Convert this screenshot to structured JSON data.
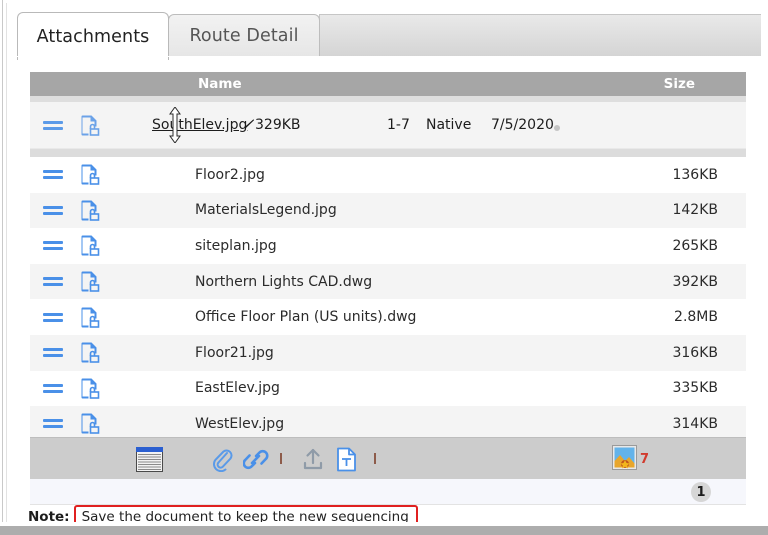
{
  "tabs": [
    {
      "label": "Attachments",
      "active": true,
      "name": "tab-attachments"
    },
    {
      "label": "Route Detail",
      "active": false,
      "name": "tab-route-detail"
    }
  ],
  "grid": {
    "columns": {
      "name": "Name",
      "size": "Size"
    },
    "drag_preview": {
      "filename": "SouthElev.jpg",
      "size": "329KB",
      "pages": "1-7",
      "type": "Native",
      "date": "7/5/2020",
      "edit_icon": "pencil-icon",
      "cursor": "vertical-move-cursor"
    },
    "rows": [
      {
        "filename": "Floor2.jpg",
        "size": "136KB"
      },
      {
        "filename": "MaterialsLegend.jpg",
        "size": "142KB"
      },
      {
        "filename": "siteplan.jpg",
        "size": "265KB"
      },
      {
        "filename": "Northern Lights CAD.dwg",
        "size": "392KB"
      },
      {
        "filename": "Office Floor Plan (US units).dwg",
        "size": "2.8MB"
      },
      {
        "filename": "Floor21.jpg",
        "size": "316KB"
      },
      {
        "filename": "EastElev.jpg",
        "size": "335KB"
      },
      {
        "filename": "WestElev.jpg",
        "size": "314KB"
      }
    ]
  },
  "toolbar": {
    "items": [
      {
        "name": "list-view-icon",
        "label": "List View"
      },
      {
        "name": "paperclip-icon",
        "label": "Attach File"
      },
      {
        "name": "link-icon",
        "label": "Add Link"
      },
      {
        "name": "upload-icon",
        "label": "Upload"
      },
      {
        "name": "text-document-icon",
        "label": "New Text Document"
      }
    ],
    "thumbnail": {
      "name": "image-thumbnail-icon",
      "count": "7"
    }
  },
  "pager": {
    "current_page": "1"
  },
  "note": {
    "label": "Note:",
    "message": "Save the document to keep the new sequencing"
  },
  "colors": {
    "accent_blue": "#4a90e8",
    "header_gray": "#a6a6a6",
    "toolbar_gray": "#cccccc",
    "alert_red": "#e02020",
    "count_red": "#d13b2e"
  }
}
